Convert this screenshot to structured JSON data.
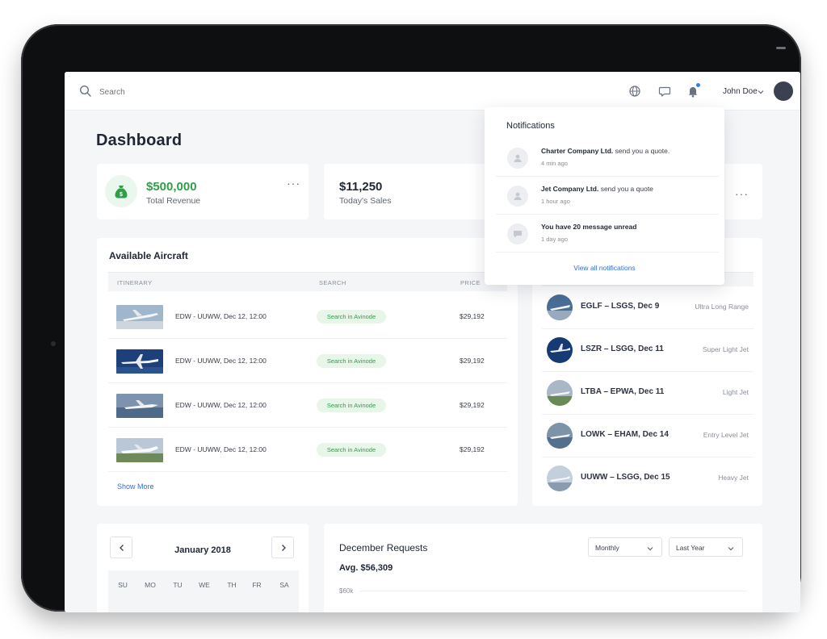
{
  "header": {
    "search_placeholder": "Search",
    "user_name": "John Doe",
    "icons": [
      "search-icon",
      "globe-icon",
      "chat-icon",
      "bell-icon",
      "chevron-down-icon"
    ]
  },
  "page": {
    "title": "Dashboard"
  },
  "stats": [
    {
      "value": "$500,000",
      "label": "Total Revenue",
      "color": "#2e9e48"
    },
    {
      "value": "$11,250",
      "label": "Today's Sales",
      "color": "#1f2634"
    }
  ],
  "aircraft": {
    "title": "Available Aircraft",
    "columns": [
      "ITINERARY",
      "SEARCH",
      "PRICE"
    ],
    "rows": [
      {
        "itinerary": "EDW - UUWW, Dec 12, 12:00",
        "search": "Search in Avinode",
        "price": "$29,192"
      },
      {
        "itinerary": "EDW - UUWW, Dec 12, 12:00",
        "search": "Search in Avinode",
        "price": "$29,192"
      },
      {
        "itinerary": "EDW - UUWW, Dec 12, 12:00",
        "search": "Search in Avinode",
        "price": "$29,192"
      },
      {
        "itinerary": "EDW - UUWW, Dec 12, 12:00",
        "search": "Search in Avinode",
        "price": "$29,192"
      }
    ],
    "show_more": "Show More"
  },
  "flights": [
    {
      "route": "EGLF – LSGS, Dec 9",
      "type": "Ultra Long Range"
    },
    {
      "route": "LSZR – LSGG, Dec 11",
      "type": "Super Light Jet"
    },
    {
      "route": "LTBA – EPWA, Dec 11",
      "type": "Light Jet"
    },
    {
      "route": "LOWK – EHAM, Dec 14",
      "type": "Entry Level Jet"
    },
    {
      "route": "UUWW – LSGG, Dec 15",
      "type": "Heavy Jet"
    }
  ],
  "calendar": {
    "month": "January 2018",
    "days": [
      "SU",
      "MO",
      "TU",
      "WE",
      "TH",
      "FR",
      "SA"
    ]
  },
  "requests": {
    "title": "December Requests",
    "avg": "Avg. $56,309",
    "period_select": "Monthly",
    "range_select": "Last Year",
    "axis_top": "$60k"
  },
  "notifications": {
    "title": "Notifications",
    "items": [
      {
        "sender": "Charter Company Ltd.",
        "message": "send you a quote.",
        "time": "4 min ago"
      },
      {
        "sender": "Jet Company Ltd.",
        "message": "send you a quote",
        "time": "1 hour ago"
      },
      {
        "sender": "You have 20 message unread",
        "message": "",
        "time": "1 day ago"
      }
    ],
    "view_all": "View all notifications"
  },
  "colors": {
    "accent_green": "#2e9e48",
    "link_blue": "#2f6fdc",
    "badge_green_bg": "#e8f6ea",
    "notification_dot": "#2f80ed"
  }
}
